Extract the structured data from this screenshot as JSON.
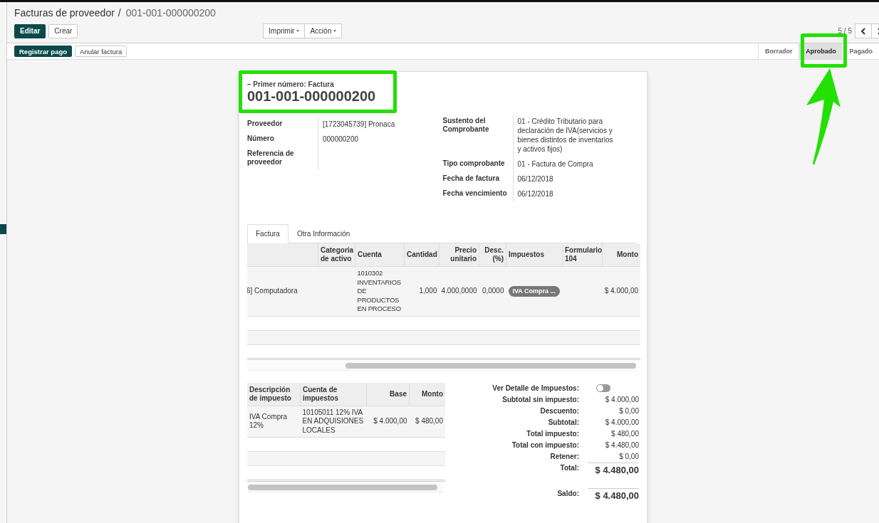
{
  "breadcrumb": {
    "parent": "Facturas de proveedor",
    "separator": "/",
    "current": "001-001-000000200"
  },
  "main_buttons": [
    {
      "label": "Editar",
      "kind": "primary"
    },
    {
      "label": "Crear",
      "kind": "secondary"
    }
  ],
  "menus": [
    "Imprimir",
    "Acción"
  ],
  "pager": {
    "value": "5 / 5"
  },
  "action_buttons": [
    {
      "label": "Registrar pago",
      "kind": "primary"
    },
    {
      "label": "Anular factura",
      "kind": "secondary"
    }
  ],
  "status_steps": [
    {
      "label": "Borrador",
      "selected": false
    },
    {
      "label": "Aprobado",
      "selected": true
    },
    {
      "label": "Pagado",
      "selected": false
    }
  ],
  "sheet": {
    "subtitle": "– Primer número: Factura",
    "number": "001-001-000000200",
    "left_fields": [
      {
        "label": "Proveedor",
        "value": "[1723045739] Pronaca"
      },
      {
        "label": "Número",
        "value": "000000200"
      },
      {
        "label": "Referencia de proveedor"
      }
    ],
    "right_fields": [
      {
        "label": "Sustento del Comprobante",
        "value": "01 - Crédito Tributario para declaración de IVA(servicios y bienes distintos de inventarios y activos fijos)"
      },
      {
        "label": "Tipo comprobante",
        "value": "01 - Factura de Compra"
      },
      {
        "label": "Fecha de factura",
        "value": "06/12/2018"
      },
      {
        "label": "Fecha vencimiento",
        "value": "06/12/2018"
      }
    ],
    "tabs": [
      {
        "label": "Factura",
        "selected": true
      },
      {
        "label": "Otra Información",
        "selected": false
      }
    ],
    "lines_table": {
      "columns": [
        null,
        "Categoria de activo",
        "Cuenta",
        "Cantidad",
        "Precio unitario",
        "Desc. (%)",
        "Impuestos",
        "Formulario 104",
        "Monto"
      ],
      "rows": [
        {
          "cells": [
            "6] Computadora",
            null,
            "1010302 INVENTARIOS DE PRODUCTOS EN PROCESO",
            "1,000",
            "4.000,0000",
            "0,0000",
            {
              "tag": "IVA Compra ..."
            },
            null,
            "$ 4.000,00"
          ]
        }
      ]
    },
    "tax_table": {
      "columns": [
        "Descripción de impuesto",
        "Cuenta de impuestos",
        "Base",
        "Monto"
      ],
      "rows": [
        {
          "cells": [
            "IVA Compra 12%",
            "10105011 12% IVA EN ADQUISIONES LOCALES",
            "$ 4.000,00",
            "$ 480,00"
          ]
        }
      ]
    },
    "tax_detail_toggle": {
      "label": "Ver Detalle de Impuestos:",
      "on": false
    },
    "totals": [
      {
        "label": "Subtotal sin impuesto:",
        "value": "$ 4.000,00",
        "kind": "line"
      },
      {
        "label": "Descuento:",
        "value": "$ 0,00",
        "kind": "line"
      },
      {
        "label": "Subtotal:",
        "value": "$ 4.000,00",
        "kind": "line"
      },
      {
        "label": "Total impuesto:",
        "value": "$ 480,00",
        "kind": "line"
      },
      {
        "label": "Total con impuesto:",
        "value": "$ 4.480,00",
        "kind": "line"
      },
      {
        "label": "Retener:",
        "value": "$ 0,00",
        "kind": "line"
      },
      {
        "label": "Total:",
        "value": "$ 4.480,00",
        "kind": "grand"
      },
      {
        "label": "Saldo:",
        "value": "$ 4.480,00",
        "kind": "balance"
      }
    ]
  },
  "annotations": [
    {
      "kind": "box"
    },
    {
      "kind": "box"
    },
    {
      "kind": "arrow"
    }
  ]
}
